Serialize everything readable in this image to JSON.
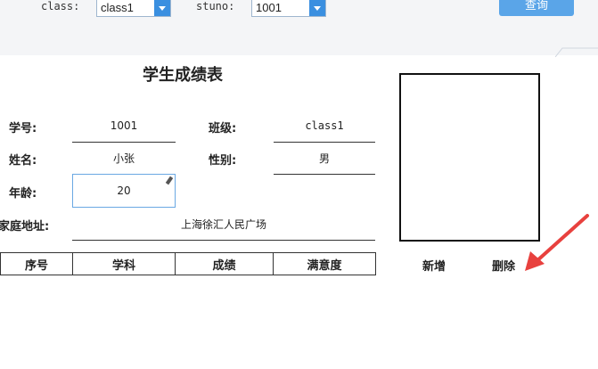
{
  "toolbar": {
    "class_label": "class:",
    "class_value": "class1",
    "stuno_label": "stuno:",
    "stuno_value": "1001",
    "query_button": "查询"
  },
  "form": {
    "title": "学生成绩表",
    "stuno_label": "学号:",
    "stuno_value": "1001",
    "class_label": "班级:",
    "class_value": "class1",
    "name_label": "姓名:",
    "name_value": "小张",
    "gender_label": "性别:",
    "gender_value": "男",
    "age_label": "年龄:",
    "age_value": "20",
    "address_label": "家庭地址:",
    "address_value": "上海徐汇人民广场"
  },
  "table": {
    "headers": [
      "序号",
      "学科",
      "成绩",
      "满意度"
    ]
  },
  "actions": {
    "add_label": "新增",
    "delete_label": "删除"
  },
  "colors": {
    "accent": "#3a8fe0",
    "annotation_arrow": "#e8413e"
  }
}
